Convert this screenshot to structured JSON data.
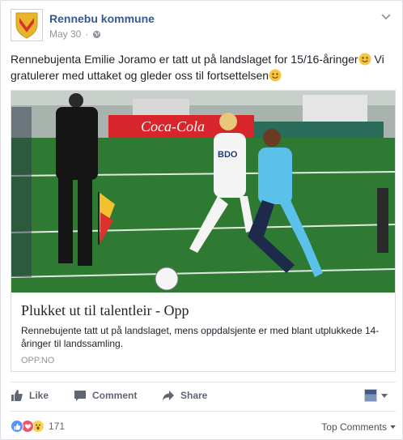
{
  "post": {
    "page_name": "Rennebu kommune",
    "date": "May 30",
    "separator": "·",
    "text_part1": "Rennebujenta Emilie Joramo er tatt ut på landslaget for 15/16-åringer",
    "text_part2": " Vi gratulerer med uttaket og gleder oss til fortsettelsen"
  },
  "link": {
    "title": "Plukket ut til talentleir - Opp",
    "description": "Rennebujente tatt ut på landslaget, mens oppdalsjente er med blant utplukkede 14-åringer til landssamling.",
    "domain": "OPP.NO",
    "photo_banner_text": "Coca-Cola",
    "jersey_text": "BDO"
  },
  "actions": {
    "like": "Like",
    "comment": "Comment",
    "share": "Share"
  },
  "footer": {
    "reaction_count": "171",
    "top_comments": "Top Comments"
  },
  "colors": {
    "link_blue": "#365899",
    "meta_gray": "#90949c",
    "like_blue": "#5890ff",
    "love_red": "#f25268",
    "wow_yellow": "#fcd34d"
  },
  "icons": [
    "coat-of-arms-icon",
    "globe-icon",
    "chevron-down-icon",
    "smile-emoji-icon",
    "like-icon",
    "comment-icon",
    "share-icon",
    "caret-down-icon",
    "like-reaction-icon",
    "love-reaction-icon",
    "wow-reaction-icon"
  ]
}
